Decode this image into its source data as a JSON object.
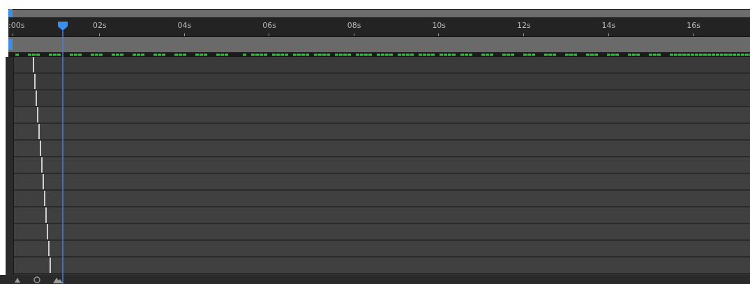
{
  "ruler": {
    "labels": [
      ":00s",
      "02s",
      "04s",
      "06s",
      "08s",
      "10s",
      "12s",
      "14s",
      "16s"
    ]
  }
}
